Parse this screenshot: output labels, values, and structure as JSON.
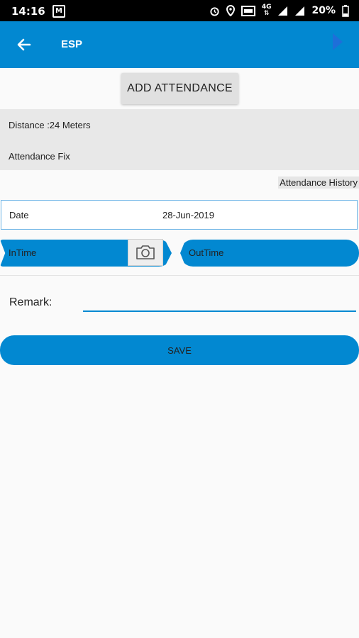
{
  "status_bar": {
    "time": "14:16",
    "app_badge": "M",
    "battery": "20%",
    "network_type": "4G"
  },
  "app_bar": {
    "title": "ESP",
    "background": "#0288d1"
  },
  "add_attendance": {
    "label": "ADD ATTENDANCE"
  },
  "info": {
    "distance": "Distance :24 Meters",
    "attendance_status": "Attendance Fix"
  },
  "attendance_history": {
    "label": "Attendance History"
  },
  "date": {
    "label": "Date",
    "value": "28-Jun-2019"
  },
  "in_time": {
    "label": "InTime"
  },
  "out_time": {
    "label": "OutTime"
  },
  "remark": {
    "label": "Remark:",
    "value": ""
  },
  "save": {
    "label": "SAVE"
  },
  "colors": {
    "accent": "#0288d1",
    "panel": "#e8e8e8"
  }
}
